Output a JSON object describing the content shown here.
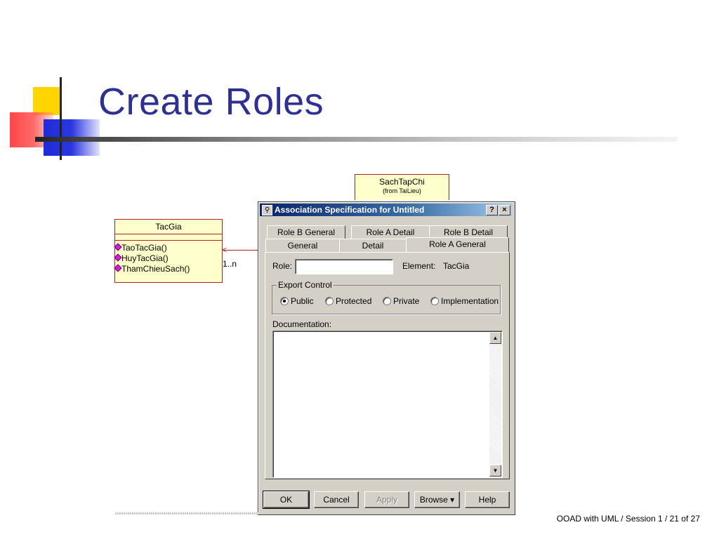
{
  "slide": {
    "title": "Create Roles",
    "footer": "OOAD with UML / Session 1 / 21 of 27"
  },
  "uml": {
    "class_tacgia": {
      "name": "TacGia",
      "operations": [
        "TaoTacGia()",
        "HuyTacGia()",
        "ThamChieuSach()"
      ]
    },
    "class_sach": {
      "name": "SachTapChi",
      "from": "(from TaiLieu)"
    },
    "multiplicity": "1..n"
  },
  "dialog": {
    "title": "Association Specification for Untitled",
    "help_btn": "?",
    "close_btn": "×",
    "tabs_back": [
      "Role B General",
      "Role A Detail",
      "Role B Detail"
    ],
    "tabs_front": [
      "General",
      "Detail",
      "Role A General"
    ],
    "active_tab": "Role A General",
    "role_label": "Role:",
    "role_value": "",
    "element_label": "Element:",
    "element_value": "TacGia",
    "export_control_label": "Export Control",
    "export_options": [
      "Public",
      "Protected",
      "Private",
      "Implementation"
    ],
    "export_selected": "Public",
    "documentation_label": "Documentation:",
    "documentation_value": "",
    "buttons": {
      "ok": "OK",
      "cancel": "Cancel",
      "apply": "Apply",
      "browse": "Browse ▾",
      "help": "Help"
    }
  }
}
